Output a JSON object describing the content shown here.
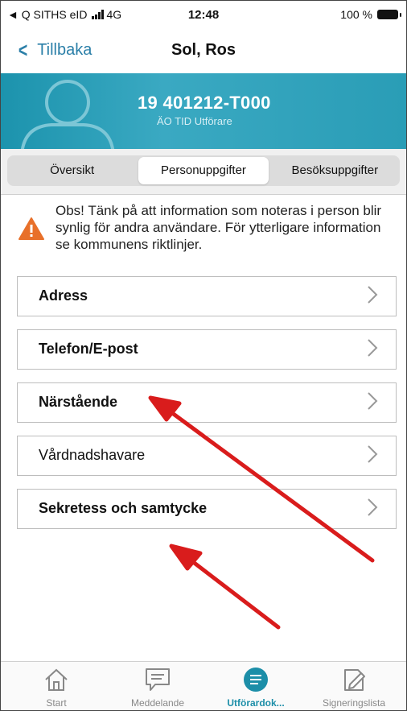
{
  "status_bar": {
    "carrier": "◄ Q SITHS eID",
    "network": "4G",
    "time": "12:48",
    "battery": "100 %"
  },
  "nav": {
    "back_label": "Tillbaka",
    "title": "Sol, Ros"
  },
  "banner": {
    "person_id": "19 401212-T000",
    "subtitle": "ÄO TID Utförare",
    "color": "#2a9db6"
  },
  "tabs": [
    {
      "label": "Översikt",
      "active": false
    },
    {
      "label": "Personuppgifter",
      "active": true
    },
    {
      "label": "Besöksuppgifter",
      "active": false
    }
  ],
  "notice": {
    "icon": "warning-triangle-icon",
    "text": "Obs! Tänk på att information som noteras i person blir synlig för andra användare. För ytterligare information se kommunens riktlinjer."
  },
  "rows": [
    {
      "label": "Adress"
    },
    {
      "label": "Telefon/E-post"
    },
    {
      "label": "Närstående"
    },
    {
      "label": "Vårdnadshavare"
    },
    {
      "label": "Sekretess och samtycke"
    }
  ],
  "tabbar": [
    {
      "label": "Start",
      "icon": "home-icon",
      "active": false
    },
    {
      "label": "Meddelande",
      "icon": "message-icon",
      "active": false
    },
    {
      "label": "Utförardok...",
      "icon": "document-list-icon",
      "active": true
    },
    {
      "label": "Signeringslista",
      "icon": "sign-icon",
      "active": false
    }
  ],
  "colors": {
    "accent": "#2b7fa8",
    "annotation_arrow": "#d91c1c",
    "warning": "#e8702a"
  }
}
